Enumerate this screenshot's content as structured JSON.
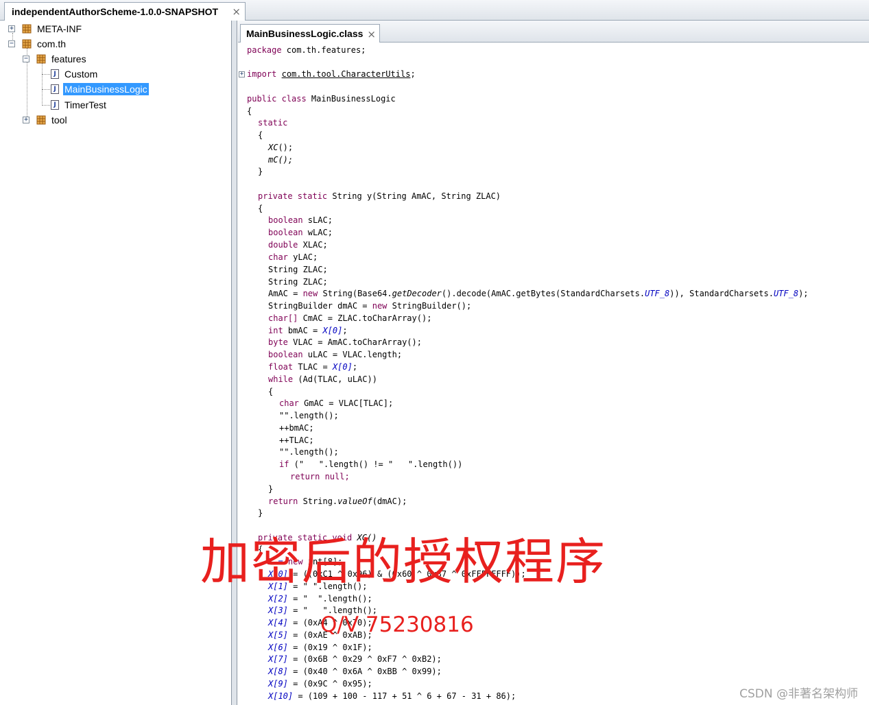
{
  "top_tab": {
    "title": "independentAuthorScheme-1.0.0-SNAPSHOT",
    "close": "×"
  },
  "tree": {
    "items": [
      {
        "label": "META-INF",
        "expander": "+"
      },
      {
        "label": "com.th",
        "expander": "−"
      },
      {
        "label": "features",
        "expander": "−"
      },
      {
        "label": "Custom",
        "icon": "J"
      },
      {
        "label": "MainBusinessLogic",
        "icon": "J",
        "selected": true
      },
      {
        "label": "TimerTest",
        "icon": "J"
      },
      {
        "label": "tool",
        "expander": "+"
      }
    ]
  },
  "editor": {
    "tab_title": "MainBusinessLogic.class",
    "close": "×",
    "fold_import": "+",
    "code": {
      "l1_kw": "package",
      "l1_rest": " com.th.features;",
      "l2_kw": "import",
      "l2_rest": "com.th.tool.CharacterUtils",
      "l3_kw": "public class",
      "l3_rest": " MainBusinessLogic",
      "brace_open": "{",
      "brace_close": "}",
      "static_kw": "static",
      "xc_call": "XC",
      "mc_call": "mC();",
      "call_tail": "();",
      "y_kw": "private static",
      "y_rest": " String y(String AmAC, String ZLAC)",
      "t_boolean": "boolean",
      "t_double": "double",
      "t_char": "char",
      "t_string": "String",
      "t_chararr": "char[]",
      "t_int": "int",
      "t_byte": "byte",
      "t_float": "float",
      "kw_new": "new",
      "kw_while": "while",
      "kw_if": "if",
      "kw_return": "return",
      "v_slac": " sLAC;",
      "v_wlac": " wLAC;",
      "v_xlac": " XLAC;",
      "v_ylac": " yLAC;",
      "v_zlac": "String ZLAC;",
      "amac_a": "AmAC = ",
      "amac_b": " String(Base64.",
      "amac_c": "getDecoder",
      "amac_d": "().decode(AmAC.getBytes(StandardCharsets.",
      "amac_e": "UTF_8",
      "amac_f": ")), StandardCharsets.",
      "amac_g": ");",
      "sb_a": "StringBuilder dmAC = ",
      "sb_b": " StringBuilder();",
      "cmac_rest": " CmAC = ZLAC.toCharArray();",
      "bmac_a": " bmAC = ",
      "x0": "X[0]",
      "semi": ";",
      "vlac_rest": " VLAC = AmAC.toCharArray();",
      "ulac_rest": " uLAC = VLAC.length;",
      "tlac_a": " TLAC = ",
      "while_rest": " (Ad(TLAC, uLAC))",
      "gmac_rest": " GmAC = VLAC[TLAC];",
      "len_empty": "\"\".length();",
      "inc_bmac": "++bmAC;",
      "inc_tlac": "++TLAC;",
      "if_rest": " (\"   \".length() != \"   \".length())",
      "ret_null": " null;",
      "ret_value_a": " String.",
      "ret_value_b": "valueOf",
      "ret_value_c": "(dmAC);",
      "xc_decl_kw": "private static void",
      "xc_decl_rest": " XC()",
      "x_new_a": "X = ",
      "x_new_b": " int[8];",
      "x_lines": [
        {
          "lhs": "X[0]",
          "rhs": " = ((0xC1 ^ 0x96) & (0x60 ^ 0x37 ^ 0xFFFFFFFF));"
        },
        {
          "lhs": "X[1]",
          "rhs": " = \" \".length();"
        },
        {
          "lhs": "X[2]",
          "rhs": " = \"  \".length();"
        },
        {
          "lhs": "X[3]",
          "rhs": " = \"   \".length();"
        },
        {
          "lhs": "X[4]",
          "rhs": " = (0xA4 ^ 0x70);"
        },
        {
          "lhs": "X[5]",
          "rhs": " = (0xAE ^ 0xAB);"
        },
        {
          "lhs": "X[6]",
          "rhs": " = (0x19 ^ 0x1F);"
        },
        {
          "lhs": "X[7]",
          "rhs": " = (0x6B ^ 0x29 ^ 0xF7 ^ 0xB2);"
        },
        {
          "lhs": "X[8]",
          "rhs": " = (0x40 ^ 0x6A ^ 0xBB ^ 0x99);"
        },
        {
          "lhs": "X[9]",
          "rhs": " = (0x9C ^ 0x95);"
        },
        {
          "lhs": "X[10]",
          "rhs": " = (109 + 100 - 117 + 51 ^ 6 + 67 - 31 + 86);"
        }
      ]
    }
  },
  "overlay": {
    "title": "加密后的授权程序",
    "contact": "Q/V 75230816"
  },
  "watermark": "CSDN @非著名架构师",
  "colors": {
    "overlay_red": "#e8201e",
    "keyword": "#7f0055",
    "number": "#2a45d6",
    "selection": "#3399ff"
  }
}
